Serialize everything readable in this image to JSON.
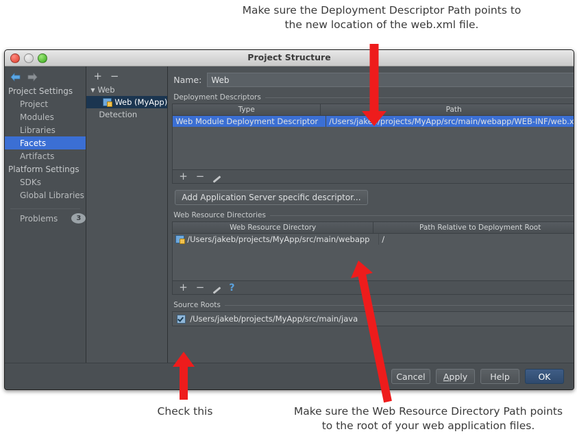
{
  "annotations": {
    "top": "Make sure the Deployment Descriptor Path points to the new location of the web.xml file.",
    "check_this": "Check this",
    "web_resource": "Make sure the Web Resource Directory Path points to the root of your web application files."
  },
  "window": {
    "title": "Project Structure",
    "traffic_lights": [
      "close-dot",
      "minimize-dot",
      "maximize-dot"
    ]
  },
  "sidebar": {
    "nav": {
      "back": "back-arrow-icon",
      "forward": "forward-arrow-icon"
    },
    "groups": [
      {
        "header": "Project Settings",
        "items": [
          {
            "label": "Project",
            "selected": false
          },
          {
            "label": "Modules",
            "selected": false
          },
          {
            "label": "Libraries",
            "selected": false
          },
          {
            "label": "Facets",
            "selected": true
          },
          {
            "label": "Artifacts",
            "selected": false
          }
        ]
      },
      {
        "header": "Platform Settings",
        "items": [
          {
            "label": "SDKs",
            "selected": false
          },
          {
            "label": "Global Libraries",
            "selected": false
          }
        ]
      }
    ],
    "problems": {
      "label": "Problems",
      "count": "3"
    }
  },
  "tree": {
    "toolbar": [
      "+",
      "−"
    ],
    "nodes": [
      {
        "label": "Web",
        "type": "group",
        "expanded": true,
        "selected": false
      },
      {
        "label": "Web (MyApp)",
        "type": "facet",
        "selected": true
      },
      {
        "label": "Detection",
        "type": "group",
        "selected": false
      }
    ]
  },
  "detail": {
    "name_label": "Name:",
    "name_value": "Web",
    "deployment_descriptors": {
      "group_label": "Deployment Descriptors",
      "columns": [
        "Type",
        "Path"
      ],
      "rows": [
        {
          "type": "Web Module Deployment Descriptor",
          "path": "/Users/jakeb/projects/MyApp/src/main/webapp/WEB-INF/web.xml",
          "selected": true
        }
      ],
      "toolbar": [
        "add",
        "remove",
        "edit"
      ],
      "add_button": "Add Application Server specific descriptor..."
    },
    "web_resource_directories": {
      "group_label": "Web Resource Directories",
      "columns": [
        "Web Resource Directory",
        "Path Relative to Deployment Root"
      ],
      "rows": [
        {
          "directory": "/Users/jakeb/projects/MyApp/src/main/webapp",
          "relative": "/"
        }
      ],
      "toolbar": [
        "add",
        "remove",
        "edit",
        "help"
      ]
    },
    "source_roots": {
      "group_label": "Source Roots",
      "rows": [
        {
          "checked": true,
          "path": "/Users/jakeb/projects/MyApp/src/main/java"
        }
      ]
    }
  },
  "footer": {
    "cancel": "Cancel",
    "apply_pre": "A",
    "apply_post": "pply",
    "help": "Help",
    "ok": "OK"
  },
  "colors": {
    "accent_blue": "#3b6fd4",
    "arrow_red": "#ee1c1c",
    "window_bg": "#4e5357",
    "sidebar_bg": "#4a4f53",
    "tree_selected": "#1b3550",
    "ok_button": "#2f4a6d"
  }
}
